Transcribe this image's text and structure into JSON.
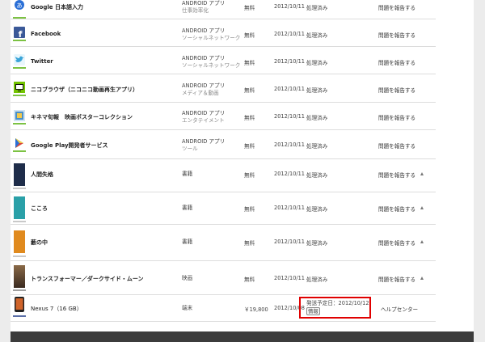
{
  "rows": [
    {
      "name": "Google 日本語入力",
      "cat": "ANDROID アプリ",
      "sub": "仕事効率化",
      "price": "無料",
      "date": "2012/10/11",
      "status": "処理済み",
      "action": "問題を報告する",
      "icon": "google-ime-icon",
      "color": "#2a6fd6"
    },
    {
      "name": "Facebook",
      "cat": "ANDROID アプリ",
      "sub": "ソーシャルネットワーク",
      "price": "無料",
      "date": "2012/10/11",
      "status": "処理済み",
      "action": "問題を報告する",
      "icon": "facebook-icon",
      "color": "#3b5998"
    },
    {
      "name": "Twitter",
      "cat": "ANDROID アプリ",
      "sub": "ソーシャルネットワーク",
      "price": "無料",
      "date": "2012/10/11",
      "status": "処理済み",
      "action": "問題を報告する",
      "icon": "twitter-icon",
      "color": "#3aa4d8"
    },
    {
      "name": "ニコブラウザ（ニコニコ動画再生アプリ）",
      "cat": "ANDROID アプリ",
      "sub": "メディア＆動画",
      "price": "無料",
      "date": "2012/10/11",
      "status": "処理済み",
      "action": "問題を報告する",
      "icon": "nico-browser-icon",
      "color": "#73c400"
    },
    {
      "name": "キネマ旬報　映画ポスターコレクション",
      "cat": "ANDROID アプリ",
      "sub": "エンタテイメント",
      "price": "無料",
      "date": "2012/10/11",
      "status": "処理済み",
      "action": "問題を報告する",
      "icon": "kinema-icon",
      "color": "#4a90c8"
    },
    {
      "name": "Google Play開発者サービス",
      "cat": "ANDROID アプリ",
      "sub": "ツール",
      "price": "無料",
      "date": "2012/10/11",
      "status": "処理済み",
      "action": "問題を報告する",
      "icon": "google-play-services-icon",
      "color": "#7cc243"
    },
    {
      "name": "人間失格",
      "cat": "書籍",
      "sub": "",
      "price": "無料",
      "date": "2012/10/11",
      "status": "処理済み",
      "action": "問題を報告する",
      "icon": "book-cover-icon",
      "color": "#1f2d4a"
    },
    {
      "name": "こころ",
      "cat": "書籍",
      "sub": "",
      "price": "無料",
      "date": "2012/10/11",
      "status": "処理済み",
      "action": "問題を報告する",
      "icon": "book-cover-icon",
      "color": "#2aa0a8"
    },
    {
      "name": "藪の中",
      "cat": "書籍",
      "sub": "",
      "price": "無料",
      "date": "2012/10/11",
      "status": "処理済み",
      "action": "問題を報告する",
      "icon": "book-cover-icon",
      "color": "#e08a1e"
    },
    {
      "name": "トランスフォーマー／ダークサイド・ムーン",
      "cat": "映画",
      "sub": "",
      "price": "無料",
      "date": "2012/10/11",
      "status": "処理済み",
      "action": "問題を報告する",
      "icon": "movie-poster-icon",
      "color": "#5a4030"
    },
    {
      "name": "Nexus 7（16 GB）",
      "cat": "端末",
      "sub": "",
      "price": "￥19,800",
      "date": "2012/10/08",
      "status": "発送予定日：2012/10/12",
      "status2": "情報",
      "action": "ヘルプセンター",
      "icon": "nexus7-icon",
      "color": "#222222"
    }
  ]
}
